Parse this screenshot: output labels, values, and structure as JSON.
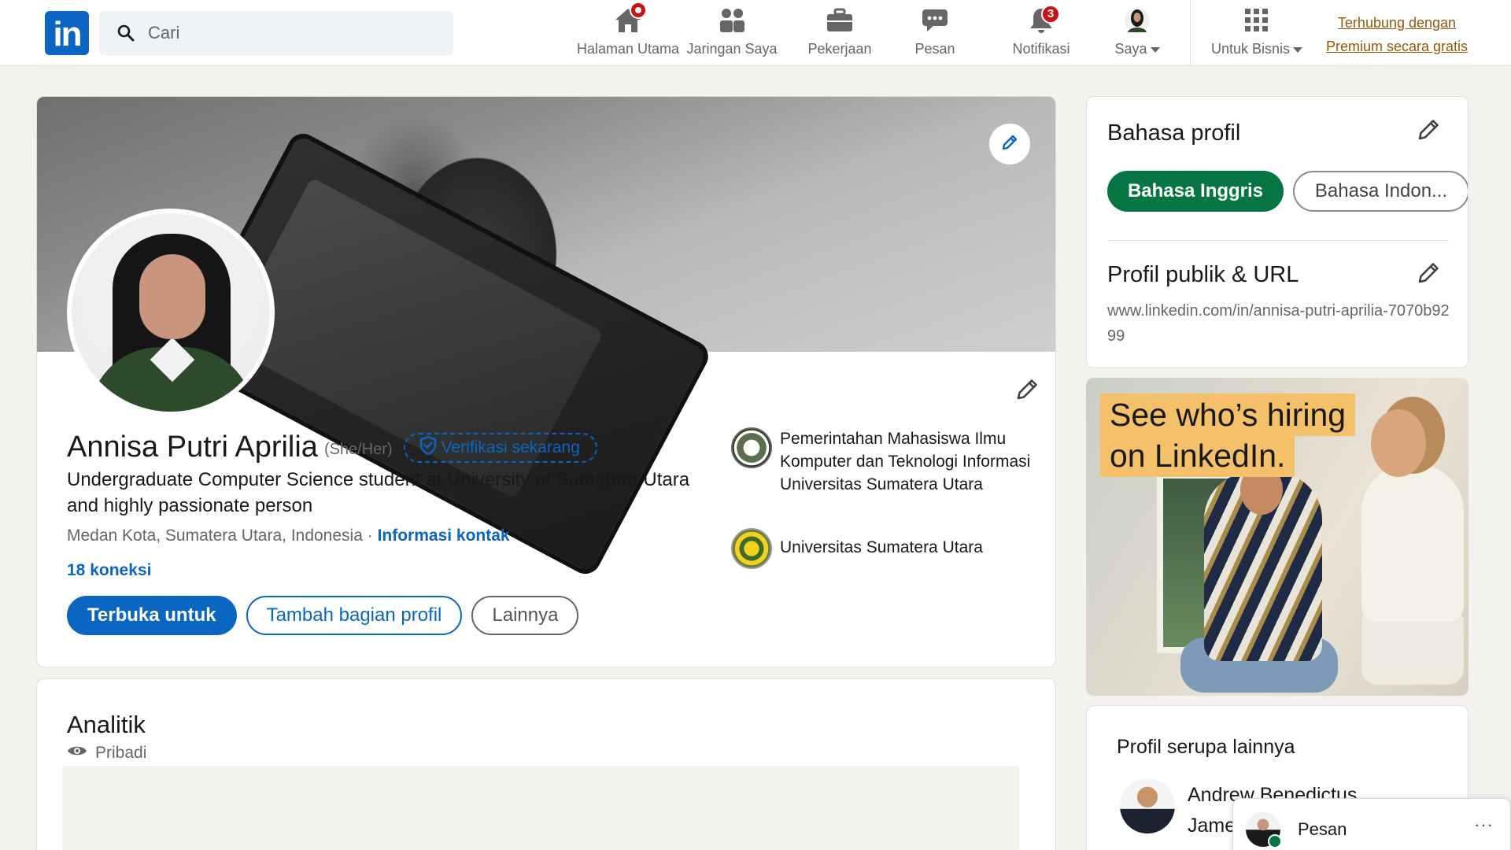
{
  "nav": {
    "logo_text": "in",
    "search_placeholder": "Cari",
    "items": [
      {
        "label": "Halaman Utama",
        "icon": "home-icon",
        "badge": ""
      },
      {
        "label": "Jaringan Saya",
        "icon": "people-icon",
        "badge": ""
      },
      {
        "label": "Pekerjaan",
        "icon": "briefcase-icon",
        "badge": ""
      },
      {
        "label": "Pesan",
        "icon": "chat-icon",
        "badge": ""
      },
      {
        "label": "Notifikasi",
        "icon": "bell-icon",
        "badge": "3"
      },
      {
        "label": "Saya",
        "icon": "avatar-icon",
        "badge": ""
      },
      {
        "label": "Untuk Bisnis",
        "icon": "grid-icon",
        "badge": ""
      }
    ],
    "premium_line1": "Terhubung dengan",
    "premium_line2": "Premium secara gratis"
  },
  "profile": {
    "name": "Annisa Putri Aprilia",
    "pronouns": "(She/Her)",
    "verify_label": "Verifikasi sekarang",
    "headline": "Undergraduate Computer Science student at University of Sumatera Utara and highly passionate person",
    "location": "Medan Kota, Sumatera Utara, Indonesia",
    "separator": " · ",
    "contact_info": "Informasi kontak",
    "connections": "18 koneksi",
    "buttons": {
      "open_to": "Terbuka untuk",
      "add_section": "Tambah bagian profil",
      "more": "Lainnya"
    },
    "affiliations": [
      {
        "name": "Pemerintahan Mahasiswa Ilmu Komputer dan Teknologi Informasi Universitas Sumatera Utara"
      },
      {
        "name": "Universitas Sumatera Utara"
      }
    ]
  },
  "analytics": {
    "title": "Analitik",
    "visibility": "Pribadi"
  },
  "sidebar": {
    "language_title": "Bahasa profil",
    "language_active": "Bahasa Inggris",
    "language_other": "Bahasa Indon...",
    "public_profile_title": "Profil publik & URL",
    "public_url": "www.linkedin.com/in/annisa-putri-aprilia-7070b9299",
    "ad_line1": "See who’s hiring",
    "ad_line2": "on LinkedIn.",
    "similar_title": "Profil serupa lainnya",
    "similar_name": "Andrew Benedictus Jame"
  },
  "messaging": {
    "label": "Pesan",
    "more": "···"
  },
  "colors": {
    "brand": "#0a66c2",
    "premium": "#915907",
    "active_chip": "#057642",
    "badge": "#cc1016",
    "ad_highlight": "#f5c06a"
  }
}
